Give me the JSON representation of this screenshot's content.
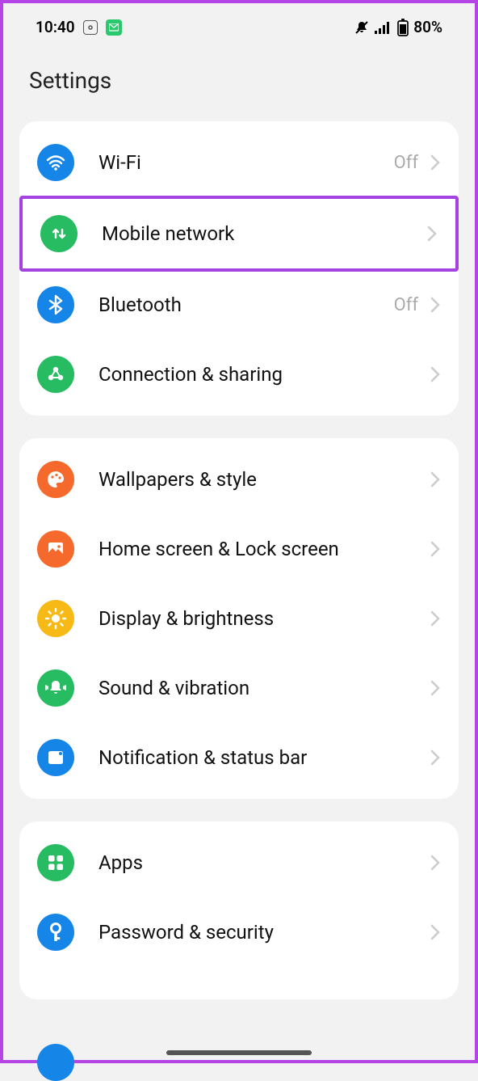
{
  "statusbar": {
    "time": "10:40",
    "battery": "80%"
  },
  "page": {
    "title": "Settings"
  },
  "sections": [
    {
      "items": [
        {
          "label": "Wi-Fi",
          "status": "Off",
          "icon": "wifi",
          "color": "#1685e8"
        },
        {
          "label": "Mobile network",
          "status": "",
          "icon": "mobile-data",
          "color": "#27bc61",
          "highlighted": true
        },
        {
          "label": "Bluetooth",
          "status": "Off",
          "icon": "bluetooth",
          "color": "#1685e8"
        },
        {
          "label": "Connection & sharing",
          "status": "",
          "icon": "connection",
          "color": "#27bc61"
        }
      ]
    },
    {
      "items": [
        {
          "label": "Wallpapers & style",
          "status": "",
          "icon": "palette",
          "color": "#f56a2c"
        },
        {
          "label": "Home screen & Lock screen",
          "status": "",
          "icon": "picture",
          "color": "#f56a2c"
        },
        {
          "label": "Display & brightness",
          "status": "",
          "icon": "brightness",
          "color": "#f7b916"
        },
        {
          "label": "Sound & vibration",
          "status": "",
          "icon": "bell",
          "color": "#27bc61"
        },
        {
          "label": "Notification & status bar",
          "status": "",
          "icon": "notification",
          "color": "#1685e8"
        }
      ]
    },
    {
      "items": [
        {
          "label": "Apps",
          "status": "",
          "icon": "apps",
          "color": "#27bc61"
        },
        {
          "label": "Password & security",
          "status": "",
          "icon": "key",
          "color": "#1685e8"
        }
      ]
    }
  ]
}
